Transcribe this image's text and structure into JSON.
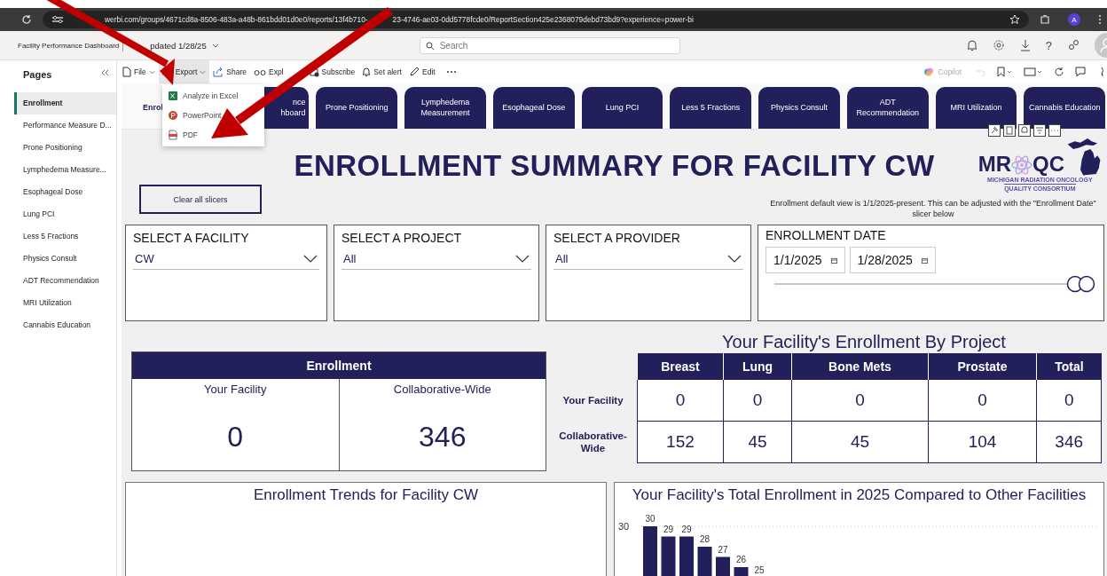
{
  "browser": {
    "url_parts": [
      "werbi.com/groups/4671cd8a-8506-483a-a48b-861bdd01d0e0/reports/13f4b710-",
      "23-4746-ae03-0dd5778fcde0/ReportSection425e2368079debd73bd9?experience=power-bi"
    ],
    "profile_initial": "A"
  },
  "header": {
    "report_title": "Facility Performance Dashboard",
    "updated": "pdated 1/28/25",
    "search_placeholder": "Search",
    "help_label": "?"
  },
  "toolbar": {
    "items": [
      {
        "label": "File",
        "kind": "file",
        "dropdown": true,
        "selected": false
      },
      {
        "label": "Export",
        "kind": "export",
        "dropdown": true,
        "selected": true
      },
      {
        "label": "Share",
        "kind": "share",
        "dropdown": false,
        "selected": false
      },
      {
        "label": "Expl",
        "kind": "explore",
        "dropdown": false,
        "selected": false
      },
      {
        "label": "Subscribe",
        "kind": "subscribe",
        "dropdown": false,
        "selected": false
      },
      {
        "label": "Set alert",
        "kind": "alert",
        "dropdown": false,
        "selected": false
      },
      {
        "label": "Edit",
        "kind": "edit",
        "dropdown": false,
        "selected": false
      }
    ],
    "copilot": "Copilot"
  },
  "export_menu": [
    {
      "label": "Analyze in Excel",
      "kind": "excel"
    },
    {
      "label": "PowerPoint",
      "kind": "powerpoint"
    },
    {
      "label": "PDF",
      "kind": "pdf"
    }
  ],
  "pages": {
    "title": "Pages",
    "items": [
      {
        "label": "Enrollment",
        "selected": true
      },
      {
        "label": "Performance Measure D...",
        "selected": false
      },
      {
        "label": "Prone Positioning",
        "selected": false
      },
      {
        "label": "Lymphedema Measure...",
        "selected": false
      },
      {
        "label": "Esophageal Dose",
        "selected": false
      },
      {
        "label": "Lung PCI",
        "selected": false
      },
      {
        "label": "Less 5 Fractions",
        "selected": false
      },
      {
        "label": "Physics Consult",
        "selected": false
      },
      {
        "label": "ADT Recommendation",
        "selected": false
      },
      {
        "label": "MRI Utilization",
        "selected": false
      },
      {
        "label": "Cannabis Education",
        "selected": false
      }
    ]
  },
  "tabs": [
    {
      "lines": [
        "Enrol"
      ],
      "selected": true
    },
    {
      "lines": [
        "nce",
        "hboard"
      ],
      "selected": false
    },
    {
      "lines": [
        "Prone Positioning"
      ],
      "selected": false
    },
    {
      "lines": [
        "Lymphedema",
        "Measurement"
      ],
      "selected": false
    },
    {
      "lines": [
        "Esophageal Dose"
      ],
      "selected": false
    },
    {
      "lines": [
        "Lung PCI"
      ],
      "selected": false
    },
    {
      "lines": [
        "Less 5 Fractions"
      ],
      "selected": false
    },
    {
      "lines": [
        "Physics Consult"
      ],
      "selected": false
    },
    {
      "lines": [
        "ADT",
        "Recommendation"
      ],
      "selected": false
    },
    {
      "lines": [
        "MRI Utilization"
      ],
      "selected": false
    },
    {
      "lines": [
        "Cannabis Education"
      ],
      "selected": false
    }
  ],
  "report": {
    "title": "ENROLLMENT SUMMARY FOR FACILITY CW",
    "logo": {
      "left": "MR",
      "right": "QC",
      "line1": "MICHIGAN RADIATION ONCOLOGY",
      "line2": "QUALITY CONSORTIUM"
    },
    "clear_button": "Clear all slicers",
    "note": "Enrollment default view is 1/1/2025-present. This can be adjusted with the \"Enrollment Date\" slicer below"
  },
  "slicers": [
    {
      "title": "SELECT A FACILITY",
      "value": "CW"
    },
    {
      "title": "SELECT A PROJECT",
      "value": "All"
    },
    {
      "title": "SELECT A PROVIDER",
      "value": "All"
    }
  ],
  "date_slicer": {
    "title": "ENROLLMENT DATE",
    "start": "1/1/2025",
    "end": "1/28/2025"
  },
  "enrollment": {
    "title": "Enrollment",
    "columns": [
      "Your Facility",
      "Collaborative-Wide"
    ],
    "values": [
      "0",
      "346"
    ]
  },
  "project": {
    "title": "Your Facility's Enrollment By Project",
    "columns": [
      "Breast",
      "Lung",
      "Bone Mets",
      "Prostate",
      "Total"
    ],
    "rows": [
      {
        "label": "Your Facility",
        "values": [
          "0",
          "0",
          "0",
          "0",
          "0"
        ]
      },
      {
        "label": "Collaborative-Wide",
        "values": [
          "152",
          "45",
          "45",
          "104",
          "346"
        ]
      }
    ]
  },
  "trends": {
    "title": "Enrollment Trends for Facility CW"
  },
  "comparison": {
    "title": "Your Facility's Total Enrollment in 2025 Compared to Other Facilities",
    "axis_label": "30",
    "bar_labels": [
      "30",
      "29",
      "29",
      "28",
      "27",
      "26",
      "25"
    ]
  }
}
